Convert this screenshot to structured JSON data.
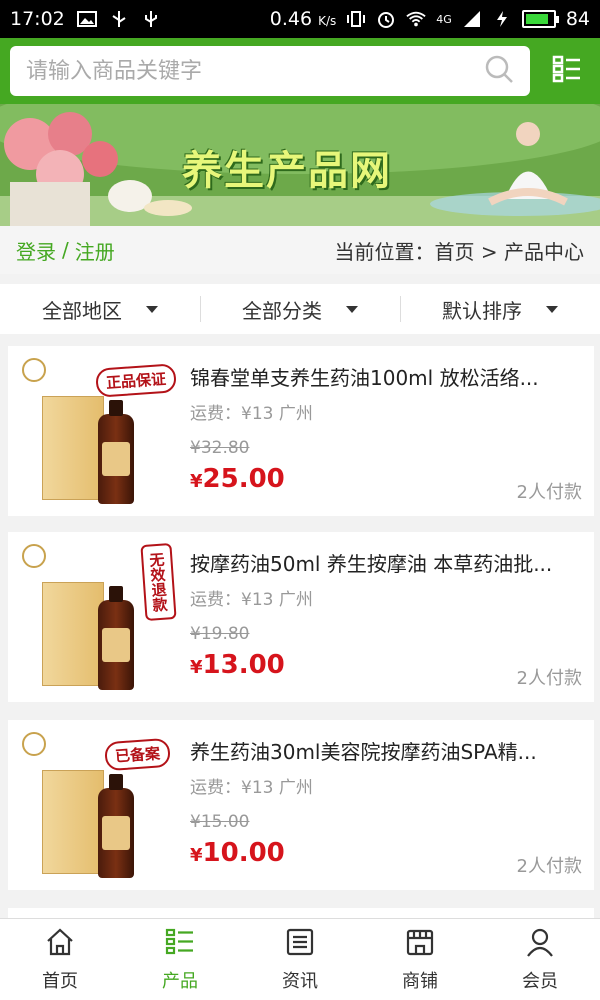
{
  "status_bar": {
    "time": "17:02",
    "speed": "0.46",
    "speed_unit": "K/s",
    "network": "4G",
    "battery": "84",
    "battery_level": 0.84
  },
  "header": {
    "search_placeholder": "请输入商品关键字"
  },
  "banner": {
    "title": "养生产品网"
  },
  "info_row": {
    "login": "登录",
    "separator": "/",
    "register": "注册",
    "breadcrumb": "当前位置：首页 > 产品中心"
  },
  "filters": [
    {
      "label": "全部地区"
    },
    {
      "label": "全部分类"
    },
    {
      "label": "默认排序"
    }
  ],
  "products": [
    {
      "title": "锦春堂单支养生药油100ml 放松活络...",
      "shipping": "运费：¥13 广州",
      "old_price": "¥32.80",
      "currency": "¥",
      "price": "25.00",
      "paid": "2人付款",
      "stamp": "正品保证"
    },
    {
      "title": "按摩药油50ml 养生按摩油 本草药油批...",
      "shipping": "运费：¥13 广州",
      "old_price": "¥19.80",
      "currency": "¥",
      "price": "13.00",
      "paid": "2人付款",
      "stamp": "无效退款"
    },
    {
      "title": "养生药油30ml美容院按摩药油SPA精...",
      "shipping": "运费：¥13 广州",
      "old_price": "¥15.00",
      "currency": "¥",
      "price": "10.00",
      "paid": "2人付款",
      "stamp": "已备案"
    }
  ],
  "tabbar": [
    {
      "label": "首页",
      "icon": "home-icon"
    },
    {
      "label": "产品",
      "icon": "list-icon",
      "active": true
    },
    {
      "label": "资讯",
      "icon": "news-icon"
    },
    {
      "label": "商铺",
      "icon": "shop-icon"
    },
    {
      "label": "会员",
      "icon": "user-icon"
    }
  ],
  "colors": {
    "brand_green": "#45a822",
    "price_red": "#d6141c"
  }
}
